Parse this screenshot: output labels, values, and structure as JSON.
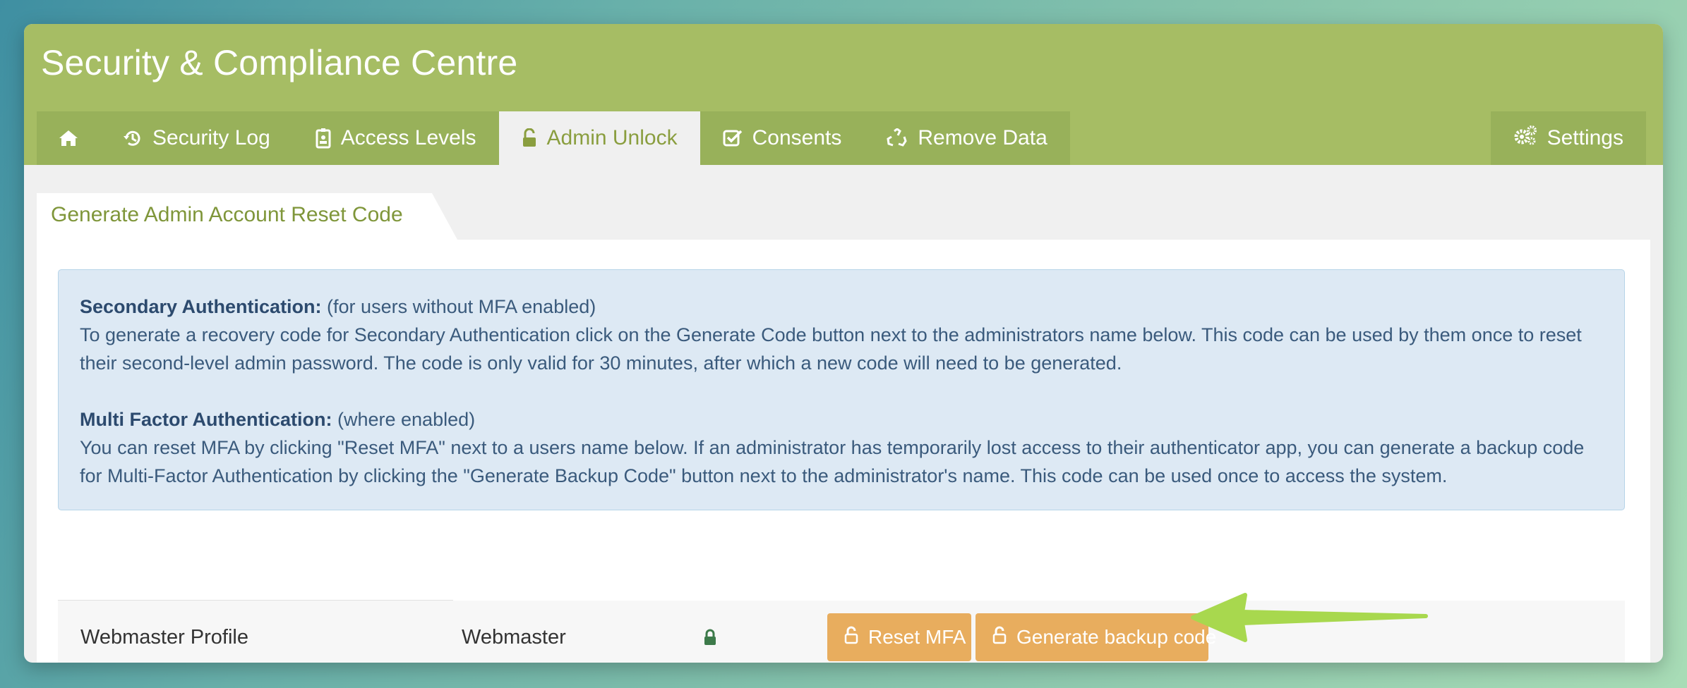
{
  "window": {
    "title": "Security & Compliance Centre"
  },
  "nav": {
    "tabs": [
      {
        "id": "home",
        "label": "",
        "icon": "home-icon"
      },
      {
        "id": "security-log",
        "label": "Security Log",
        "icon": "history-icon"
      },
      {
        "id": "access-levels",
        "label": "Access Levels",
        "icon": "badge-icon"
      },
      {
        "id": "admin-unlock",
        "label": "Admin Unlock",
        "icon": "unlock-icon",
        "active": true
      },
      {
        "id": "consents",
        "label": "Consents",
        "icon": "check-square-icon"
      },
      {
        "id": "remove-data",
        "label": "Remove Data",
        "icon": "recycle-icon"
      }
    ],
    "settings": {
      "label": "Settings",
      "icon": "gears-icon"
    }
  },
  "panel": {
    "tab_label": "Generate Admin Account Reset Code"
  },
  "info": {
    "secondary_heading": "Secondary Authentication:",
    "secondary_note": " (for users without MFA enabled)",
    "secondary_text": "To generate a recovery code for Secondary Authentication click on the Generate Code button next to the administrators name below. This code can be used by them once to reset their second-level admin password. The code is only valid for 30 minutes, after which a new code will need to be generated.",
    "mfa_heading": "Multi Factor Authentication:",
    "mfa_note": " (where enabled)",
    "mfa_text": "You can reset MFA by clicking \"Reset MFA\" next to a users name below. If an administrator has temporarily lost access to their authenticator app, you can generate a backup code for Multi-Factor Authentication by clicking the \"Generate Backup Code\" button next to the administrator's name. This code can be used once to access the system."
  },
  "admins": [
    {
      "profile": "Webmaster Profile",
      "role": "Webmaster",
      "status_icon": "lock-icon",
      "reset_label": "Reset MFA",
      "backup_label": "Generate backup code"
    }
  ],
  "colors": {
    "header": "#a6bd64",
    "tab": "#98b15a",
    "active_tab_text": "#8a9e3f",
    "button": "#e8ad5e",
    "info_bg": "#dde9f4",
    "info_text": "#3a5a7c",
    "arrow": "#a8d84e"
  }
}
